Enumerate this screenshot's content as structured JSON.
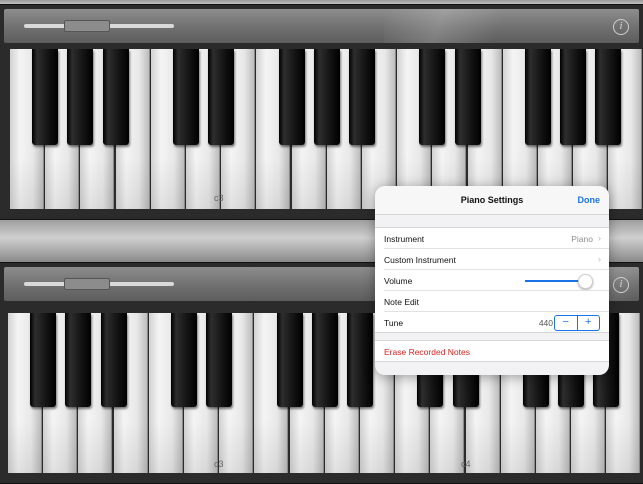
{
  "keyboard_top": {
    "info_label": "i",
    "labels": [
      {
        "text": "c3"
      }
    ]
  },
  "keyboard_bottom": {
    "info_label": "i",
    "labels": [
      {
        "text": "c3"
      },
      {
        "text": "c4"
      }
    ]
  },
  "piano_settings": {
    "title": "Piano Settings",
    "done_label": "Done",
    "rows": {
      "instrument": {
        "label": "Instrument",
        "value": "Piano"
      },
      "custom_instrument": {
        "label": "Custom Instrument"
      },
      "volume": {
        "label": "Volume",
        "level": 0.95
      },
      "note_edit": {
        "label": "Note Edit"
      },
      "tune": {
        "label": "Tune",
        "value": "440",
        "minus": "−",
        "plus": "+"
      }
    },
    "erase_label": "Erase Recorded Notes"
  },
  "colors": {
    "accent": "#1a73e8",
    "destructive": "#e02020"
  }
}
